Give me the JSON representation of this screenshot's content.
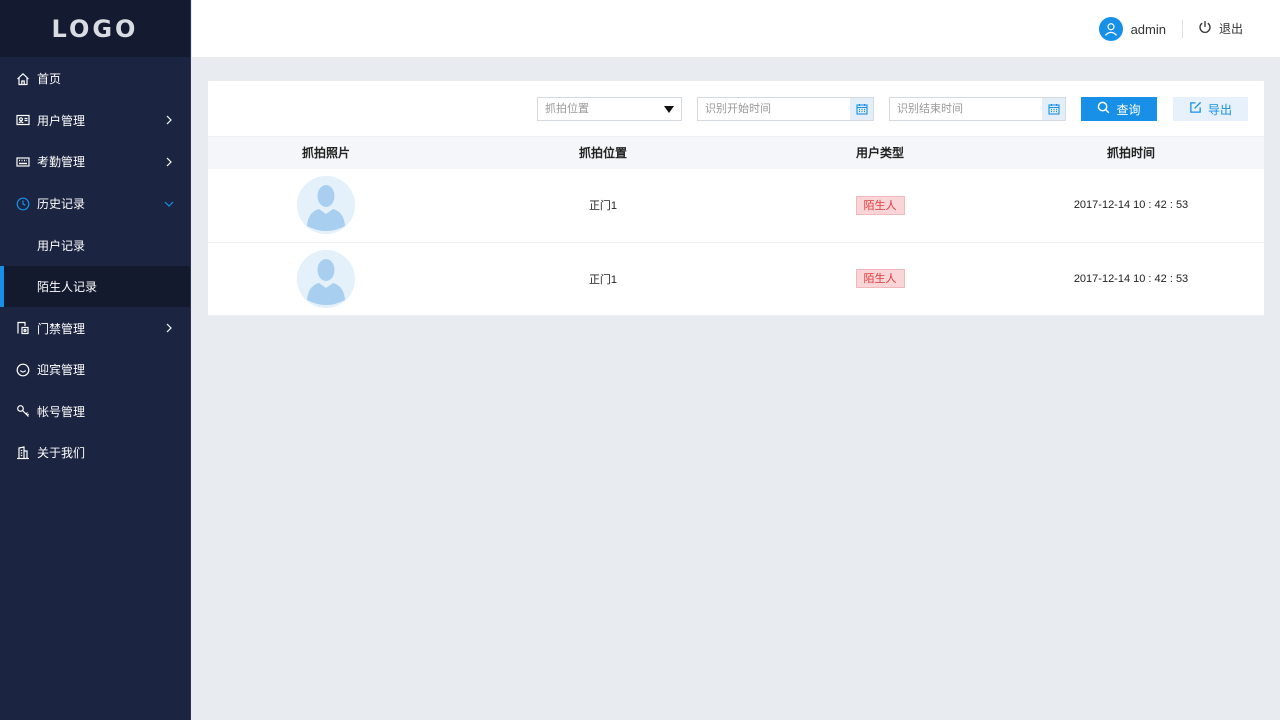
{
  "logo": "LOGO",
  "sidebar": {
    "items": [
      {
        "label": "首页",
        "icon": "home-icon"
      },
      {
        "label": "用户管理",
        "icon": "id-card-icon"
      },
      {
        "label": "考勤管理",
        "icon": "keyboard-icon"
      },
      {
        "label": "历史记录",
        "icon": "clock-icon"
      },
      {
        "label": "门禁管理",
        "icon": "door-icon"
      },
      {
        "label": "迎宾管理",
        "icon": "smile-icon"
      },
      {
        "label": "帐号管理",
        "icon": "key-icon"
      },
      {
        "label": "关于我们",
        "icon": "building-icon"
      }
    ],
    "sub_items": [
      {
        "label": "用户记录"
      },
      {
        "label": "陌生人记录",
        "active": true
      }
    ]
  },
  "header": {
    "username": "admin",
    "logout_label": "退出"
  },
  "filters": {
    "location_placeholder": "抓拍位置",
    "start_placeholder": "识别开始时间",
    "end_placeholder": "识别结束时间",
    "query_label": "查询",
    "export_label": "导出"
  },
  "table": {
    "headers": [
      "抓拍照片",
      "抓拍位置",
      "用户类型",
      "抓拍时间"
    ],
    "rows": [
      {
        "location": "正门1",
        "type": "陌生人",
        "time": "2017-12-14 10 : 42 : 53"
      },
      {
        "location": "正门1",
        "type": "陌生人",
        "time": "2017-12-14 10 : 42 : 53"
      }
    ]
  },
  "colors": {
    "sidebar_bg": "#1b2440",
    "accent": "#1890e8",
    "tag_bg": "#f9d5d8",
    "tag_text": "#e0393e"
  }
}
